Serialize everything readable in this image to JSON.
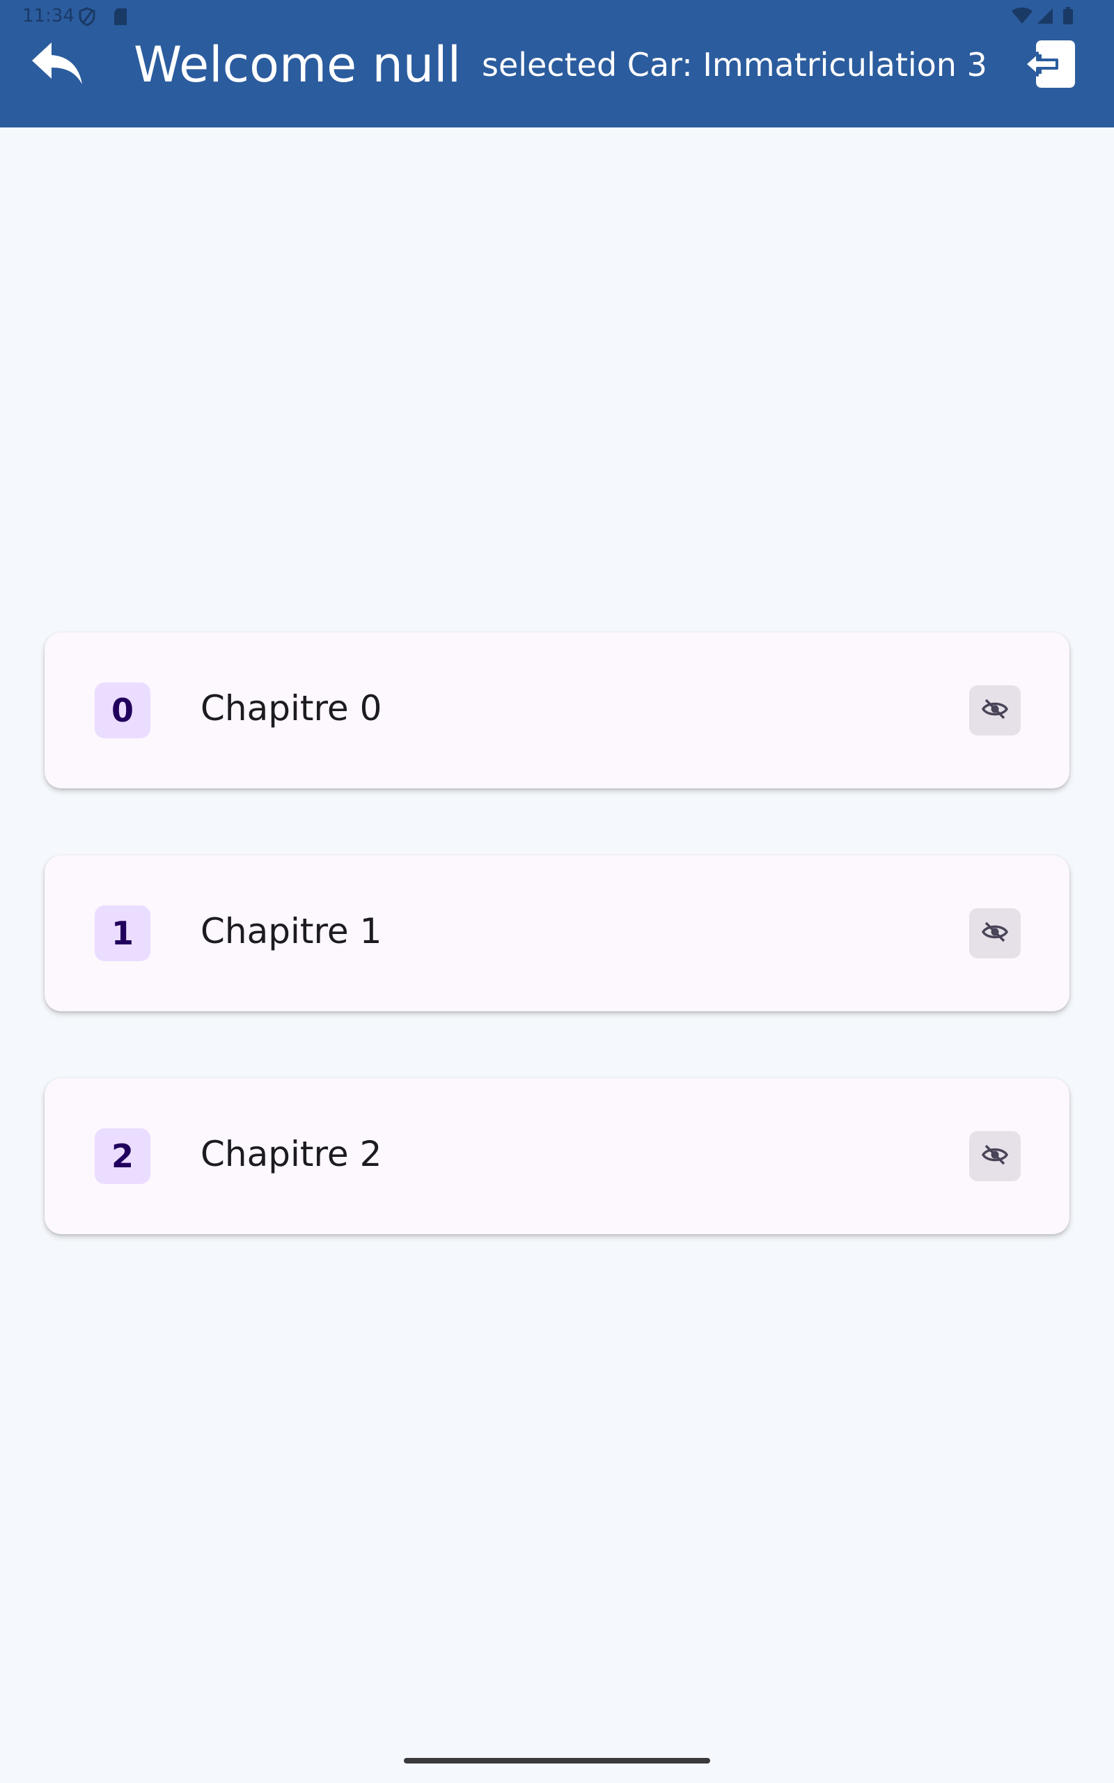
{
  "status_bar": {
    "time": "11:34",
    "icons": [
      "shield-icon",
      "sd-card-icon",
      "wifi-icon",
      "signal-icon",
      "battery-icon"
    ]
  },
  "app_bar": {
    "title": "Welcome null",
    "subtitle": "selected Car: Immatriculation 3",
    "back_icon": "reply-arrow-icon",
    "logout_icon": "logout-icon",
    "background_color": "#2B5C9E"
  },
  "chapters": [
    {
      "index": "0",
      "label": "Chapitre 0",
      "visibility_icon": "eye-off-icon"
    },
    {
      "index": "1",
      "label": "Chapitre 1",
      "visibility_icon": "eye-off-icon"
    },
    {
      "index": "2",
      "label": "Chapitre 2",
      "visibility_icon": "eye-off-icon"
    }
  ],
  "colors": {
    "background": "#F5F8FC",
    "card": "#FDF7FE",
    "index_badge": "#EADDFF",
    "index_text": "#21005D"
  }
}
